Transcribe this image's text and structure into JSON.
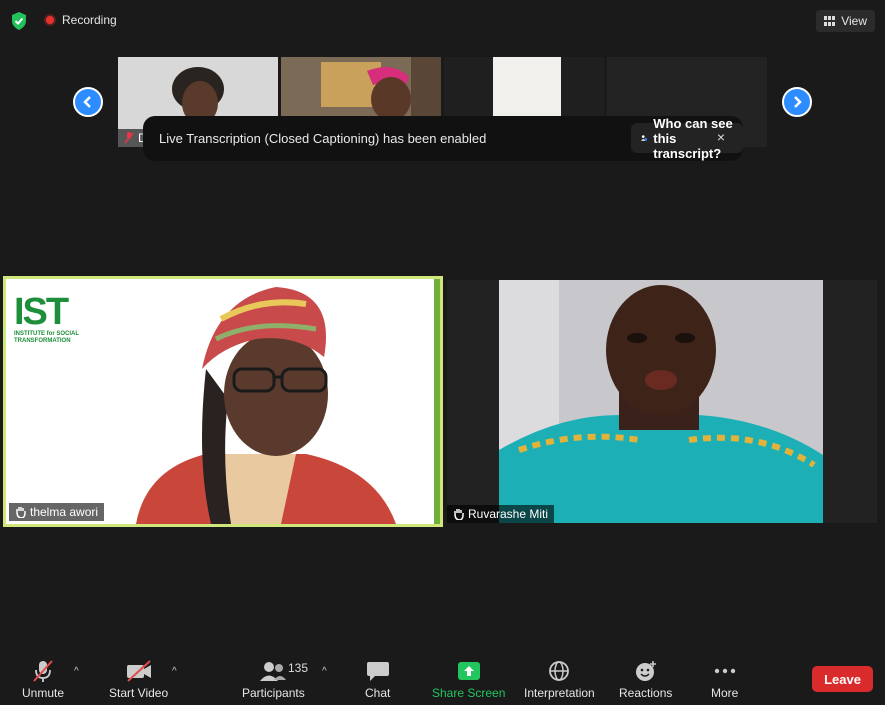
{
  "topbar": {
    "recording_label": "Recording",
    "view_label": "View"
  },
  "gallery": {
    "thumb1_name": "Da"
  },
  "caption": {
    "message": "Live Transcription (Closed Captioning) has been enabled",
    "who_can_see": "Who can see this transcript?",
    "close": "×"
  },
  "main_videos": [
    {
      "name": "thelma awori",
      "logo_text": "IST",
      "logo_sub": "INSTITUTE for SOCIAL TRANSFORMATION"
    },
    {
      "name": "Ruvarashe Miti"
    }
  ],
  "toolbar": {
    "unmute": "Unmute",
    "start_video": "Start Video",
    "participants": "Participants",
    "participants_count": "135",
    "chat": "Chat",
    "share_screen": "Share Screen",
    "interpretation": "Interpretation",
    "reactions": "Reactions",
    "more": "More",
    "leave": "Leave"
  },
  "colors": {
    "accent_blue": "#2d8cff",
    "share_green": "#22c65e",
    "leave_red": "#d92b2b",
    "speaker_border": "#cfe77a"
  }
}
